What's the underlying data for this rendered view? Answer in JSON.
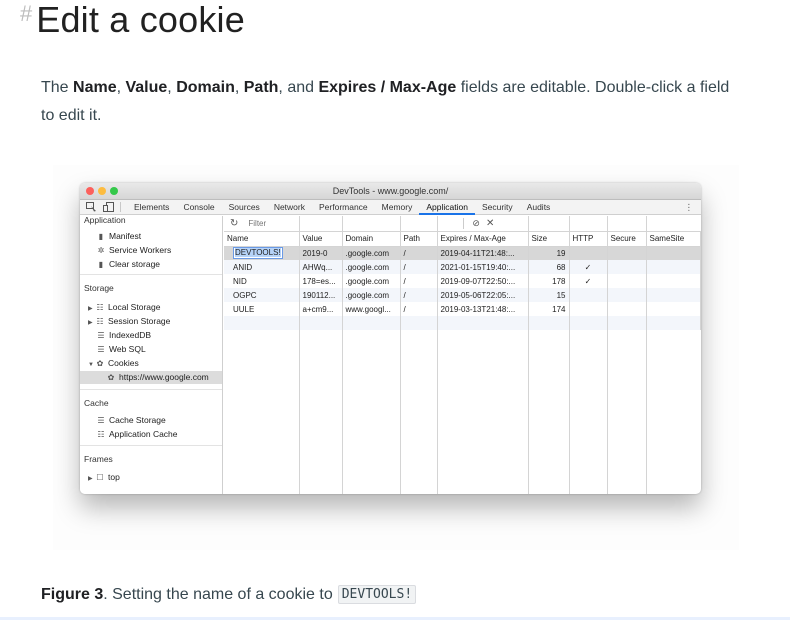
{
  "heading": {
    "hash": "#",
    "title": "Edit a cookie"
  },
  "intro": {
    "t1": "The ",
    "f1": "Name",
    "t2": ", ",
    "f2": "Value",
    "t3": ", ",
    "f3": "Domain",
    "t4": ", ",
    "f4": "Path",
    "t5": ", and ",
    "f5": "Expires / Max-Age",
    "t6": " fields are editable. Double-click a field to edit it."
  },
  "devtools": {
    "window_title": "DevTools - www.google.com/",
    "tabs": [
      "Elements",
      "Console",
      "Sources",
      "Network",
      "Performance",
      "Memory",
      "Application",
      "Security",
      "Audits"
    ],
    "active_tab": "Application",
    "sidebar": {
      "application": {
        "label": "Application",
        "items": [
          "Manifest",
          "Service Workers",
          "Clear storage"
        ]
      },
      "storage": {
        "label": "Storage",
        "items": [
          "Local Storage",
          "Session Storage",
          "IndexedDB",
          "Web SQL",
          "Cookies"
        ],
        "cookie_origin": "https://www.google.com"
      },
      "cache": {
        "label": "Cache",
        "items": [
          "Cache Storage",
          "Application Cache"
        ]
      },
      "frames": {
        "label": "Frames",
        "items": [
          "top"
        ]
      }
    },
    "filter_placeholder": "Filter",
    "columns": [
      "Name",
      "Value",
      "Domain",
      "Path",
      "Expires / Max-Age",
      "Size",
      "HTTP",
      "Secure",
      "SameSite"
    ],
    "rows": [
      {
        "name": "DEVTOOLS!",
        "value": "2019-0",
        "domain": ".google.com",
        "path": "/",
        "expires": "2019-04-11T21:48:...",
        "size": "19",
        "http": "",
        "secure": "",
        "samesite": ""
      },
      {
        "name": "ANID",
        "value": "AHWq...",
        "domain": ".google.com",
        "path": "/",
        "expires": "2021-01-15T19:40:...",
        "size": "68",
        "http": "✓",
        "secure": "",
        "samesite": ""
      },
      {
        "name": "NID",
        "value": "178=es...",
        "domain": ".google.com",
        "path": "/",
        "expires": "2019-09-07T22:50:...",
        "size": "178",
        "http": "✓",
        "secure": "",
        "samesite": ""
      },
      {
        "name": "OGPC",
        "value": "190112...",
        "domain": ".google.com",
        "path": "/",
        "expires": "2019-05-06T22:05:...",
        "size": "15",
        "http": "",
        "secure": "",
        "samesite": ""
      },
      {
        "name": "UULE",
        "value": "a+cm9...",
        "domain": "www.googl...",
        "path": "/",
        "expires": "2019-03-13T21:48:...",
        "size": "174",
        "http": "",
        "secure": "",
        "samesite": ""
      }
    ]
  },
  "caption": {
    "label": "Figure 3",
    "text": ". Setting the name of a cookie to ",
    "code": "DEVTOOLS!"
  },
  "colors": {
    "active_tab_underline": "#1a73e8",
    "selected_row": "#d7d7d7",
    "edit_highlight": "#b6d3f8"
  }
}
